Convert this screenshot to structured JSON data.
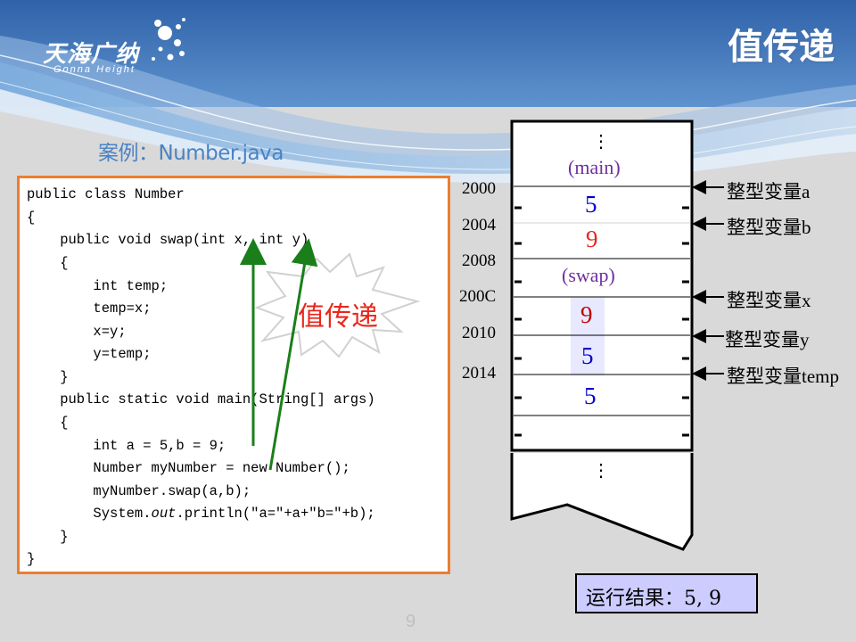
{
  "brand": {
    "logo_text": "天海广纳",
    "logo_subtext": "Gonna Height"
  },
  "slide": {
    "title": "值传递",
    "case_label": "案例：Number.java",
    "page_number": "9"
  },
  "code": {
    "lines": [
      "public class Number",
      "{",
      "    public void swap(int x, int y)",
      "    {",
      "        int temp;",
      "        temp=x;",
      "        x=y;",
      "        y=temp;",
      "    }",
      "    public static void main(String[] args)",
      "    {",
      "        int a = 5,b = 9;",
      "        Number myNumber = new Number();",
      "        myNumber.swap(a,b);",
      "        System.",
      "    }",
      "}"
    ],
    "println_italic": "out",
    "println_rest": ".println(\"a=\"+a+\"b=\"+b);"
  },
  "annotation": {
    "burst_text": "值传递"
  },
  "stack": {
    "dots_top": "⋮",
    "dots_bottom": "⋮",
    "frame_main": "(main)",
    "frame_swap": "(swap)",
    "addresses": [
      "2000",
      "2004",
      "2008",
      "200C",
      "2010",
      "2014"
    ],
    "values": [
      {
        "text": "5",
        "color": "#0000cc"
      },
      {
        "text": "9",
        "color": "#e8261c"
      },
      {
        "text": "9",
        "color": "#c00000"
      },
      {
        "text": "5",
        "color": "#0000cc"
      },
      {
        "text": "5",
        "color": "#0000cc"
      }
    ],
    "pointers": [
      {
        "cn": "整型变量",
        "en": "a"
      },
      {
        "cn": "整型变量",
        "en": "b"
      },
      {
        "cn": "整型变量",
        "en": "x"
      },
      {
        "cn": "整型变量",
        "en": "y"
      },
      {
        "cn": "整型变量",
        "en": "temp"
      }
    ]
  },
  "result": {
    "text": "运行结果：5, 9"
  },
  "colors": {
    "code_border": "#ed7d31",
    "arrow_green": "#1a7f1a",
    "result_bg": "#ccccff",
    "swap_cell_bg": "#e8e8ff"
  }
}
